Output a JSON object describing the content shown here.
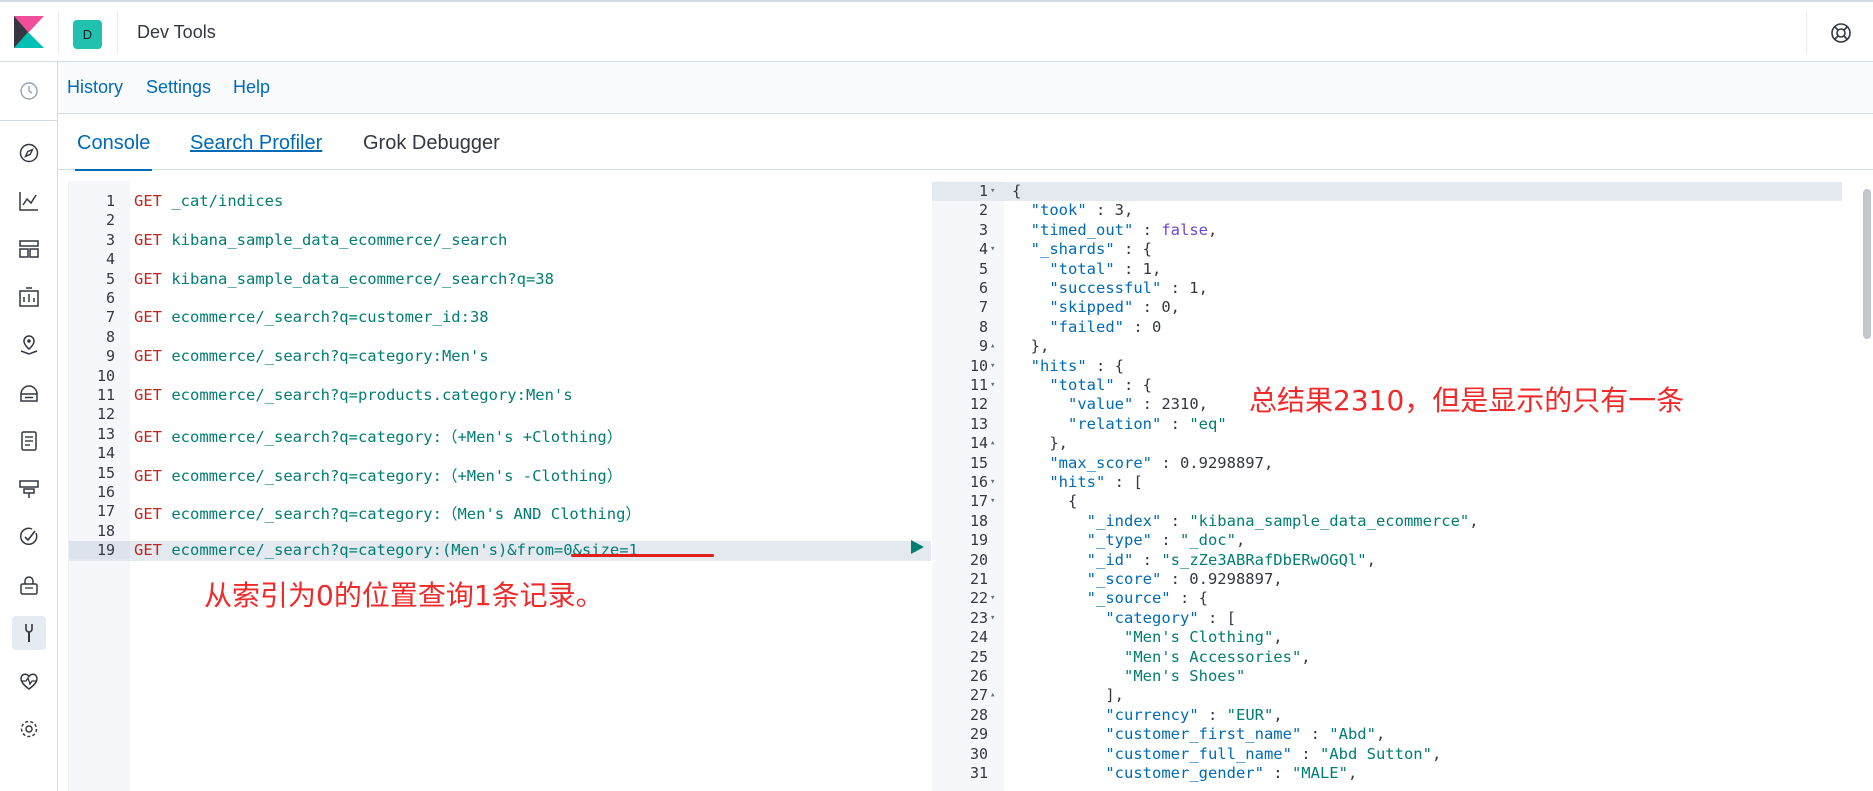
{
  "header": {
    "avatar_letter": "D",
    "title": "Dev Tools"
  },
  "sub_menu": {
    "history": "History",
    "settings": "Settings",
    "help": "Help"
  },
  "tabs": [
    {
      "label": "Console"
    },
    {
      "label": "Search Profiler"
    },
    {
      "label": "Grok Debugger"
    }
  ],
  "request_lines": [
    {
      "n": "1",
      "method": "GET",
      "path": " _cat/indices"
    },
    {
      "n": "2",
      "method": "",
      "path": ""
    },
    {
      "n": "3",
      "method": "GET",
      "path": " kibana_sample_data_ecommerce/_search"
    },
    {
      "n": "4",
      "method": "",
      "path": ""
    },
    {
      "n": "5",
      "method": "GET",
      "path": " kibana_sample_data_ecommerce/_search?q=38"
    },
    {
      "n": "6",
      "method": "",
      "path": ""
    },
    {
      "n": "7",
      "method": "GET",
      "path": " ecommerce/_search?q=customer_id:38"
    },
    {
      "n": "8",
      "method": "",
      "path": ""
    },
    {
      "n": "9",
      "method": "GET",
      "path": " ecommerce/_search?q=category:Men's"
    },
    {
      "n": "10",
      "method": "",
      "path": ""
    },
    {
      "n": "11",
      "method": "GET",
      "path": " ecommerce/_search?q=products.category:Men's"
    },
    {
      "n": "12",
      "method": "",
      "path": ""
    },
    {
      "n": "13",
      "method": "GET",
      "path": " ecommerce/_search?q=category:（+Men's +Clothing）"
    },
    {
      "n": "14",
      "method": "",
      "path": ""
    },
    {
      "n": "15",
      "method": "GET",
      "path": " ecommerce/_search?q=category:（+Men's -Clothing）"
    },
    {
      "n": "16",
      "method": "",
      "path": ""
    },
    {
      "n": "17",
      "method": "GET",
      "path": " ecommerce/_search?q=category:（Men's AND Clothing）"
    },
    {
      "n": "18",
      "method": "",
      "path": ""
    },
    {
      "n": "19",
      "method": "GET",
      "path": " ecommerce/_search?q=category:(Men's)&from=0&size=1"
    }
  ],
  "response_lines": [
    {
      "n": "1",
      "fold": "▾",
      "text": "{"
    },
    {
      "n": "2",
      "fold": "",
      "text": "  \"took\" : 3,"
    },
    {
      "n": "3",
      "fold": "",
      "text": "  \"timed_out\" : false,"
    },
    {
      "n": "4",
      "fold": "▾",
      "text": "  \"_shards\" : {"
    },
    {
      "n": "5",
      "fold": "",
      "text": "    \"total\" : 1,"
    },
    {
      "n": "6",
      "fold": "",
      "text": "    \"successful\" : 1,"
    },
    {
      "n": "7",
      "fold": "",
      "text": "    \"skipped\" : 0,"
    },
    {
      "n": "8",
      "fold": "",
      "text": "    \"failed\" : 0"
    },
    {
      "n": "9",
      "fold": "▴",
      "text": "  },"
    },
    {
      "n": "10",
      "fold": "▾",
      "text": "  \"hits\" : {"
    },
    {
      "n": "11",
      "fold": "▾",
      "text": "    \"total\" : {"
    },
    {
      "n": "12",
      "fold": "",
      "text": "      \"value\" : 2310,"
    },
    {
      "n": "13",
      "fold": "",
      "text": "      \"relation\" : \"eq\""
    },
    {
      "n": "14",
      "fold": "▴",
      "text": "    },"
    },
    {
      "n": "15",
      "fold": "",
      "text": "    \"max_score\" : 0.9298897,"
    },
    {
      "n": "16",
      "fold": "▾",
      "text": "    \"hits\" : ["
    },
    {
      "n": "17",
      "fold": "▾",
      "text": "      {"
    },
    {
      "n": "18",
      "fold": "",
      "text": "        \"_index\" : \"kibana_sample_data_ecommerce\","
    },
    {
      "n": "19",
      "fold": "",
      "text": "        \"_type\" : \"_doc\","
    },
    {
      "n": "20",
      "fold": "",
      "text": "        \"_id\" : \"s_zZe3ABRafDbERwOGQl\","
    },
    {
      "n": "21",
      "fold": "",
      "text": "        \"_score\" : 0.9298897,"
    },
    {
      "n": "22",
      "fold": "▾",
      "text": "        \"_source\" : {"
    },
    {
      "n": "23",
      "fold": "▾",
      "text": "          \"category\" : ["
    },
    {
      "n": "24",
      "fold": "",
      "text": "            \"Men's Clothing\","
    },
    {
      "n": "25",
      "fold": "",
      "text": "            \"Men's Accessories\","
    },
    {
      "n": "26",
      "fold": "",
      "text": "            \"Men's Shoes\""
    },
    {
      "n": "27",
      "fold": "▴",
      "text": "          ],"
    },
    {
      "n": "28",
      "fold": "",
      "text": "          \"currency\" : \"EUR\","
    },
    {
      "n": "29",
      "fold": "",
      "text": "          \"customer_first_name\" : \"Abd\","
    },
    {
      "n": "30",
      "fold": "",
      "text": "          \"customer_full_name\" : \"Abd Sutton\","
    },
    {
      "n": "31",
      "fold": "",
      "text": "          \"customer_gender\" : \"MALE\","
    }
  ],
  "annotations": {
    "request_note": "从索引为0的位置查询1条记录。",
    "response_note": "总结果2310，但是显示的只有一条"
  },
  "colors": {
    "accent": "#006bb4",
    "method": "#bd271e",
    "url": "#017d73",
    "note": "#ef2a2a",
    "avatar": "#20c1ae"
  }
}
